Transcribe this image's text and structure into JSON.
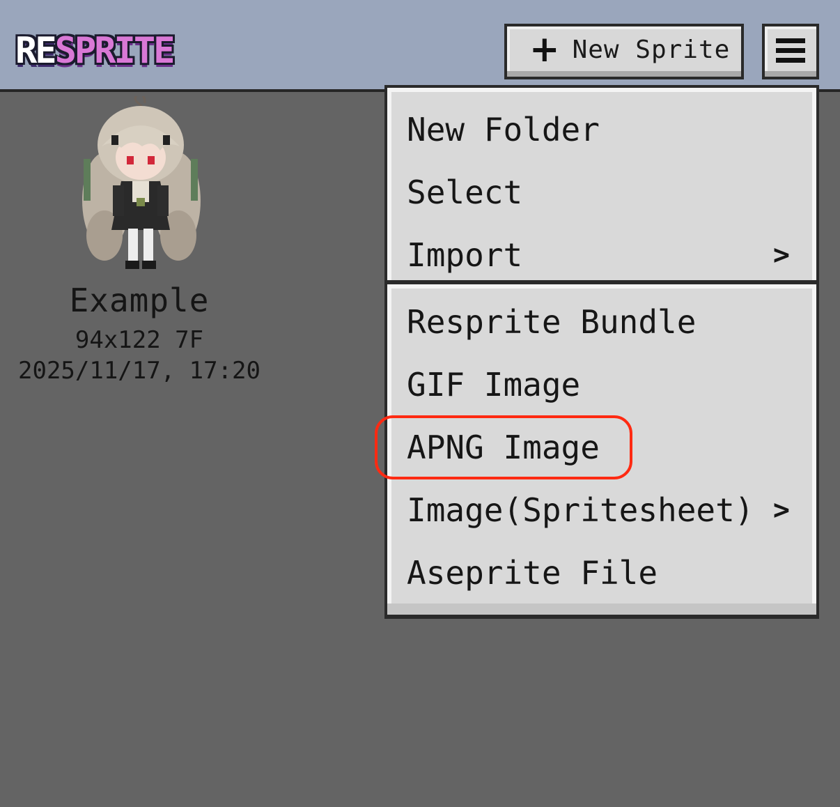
{
  "app": {
    "logo_re": "RE",
    "logo_sprite": "SPRITE"
  },
  "header": {
    "new_sprite_label": "New Sprite",
    "new_sprite_icon": "plus-icon",
    "menu_icon": "hamburger-menu-icon"
  },
  "sprite": {
    "name": "Example",
    "dims": "94x122 7F",
    "modified": "2025/11/17, 17:20"
  },
  "menu": {
    "section1": [
      {
        "label": "New Folder",
        "submenu": false
      },
      {
        "label": "Select",
        "submenu": false
      },
      {
        "label": "Import",
        "submenu": true
      }
    ],
    "section2": [
      {
        "label": "Resprite Bundle",
        "submenu": false
      },
      {
        "label": "GIF Image",
        "submenu": false
      },
      {
        "label": "APNG Image",
        "submenu": false
      },
      {
        "label": "Image(Spritesheet)",
        "submenu": true
      },
      {
        "label": "Aseprite File",
        "submenu": false
      }
    ],
    "submenu_arrow": ">"
  },
  "colors": {
    "header_bg": "#9aa6bc",
    "canvas_bg": "#646464",
    "menu_bg": "#d9d9d9",
    "highlight": "#ff2a12",
    "logo_pink": "#d978d6"
  }
}
